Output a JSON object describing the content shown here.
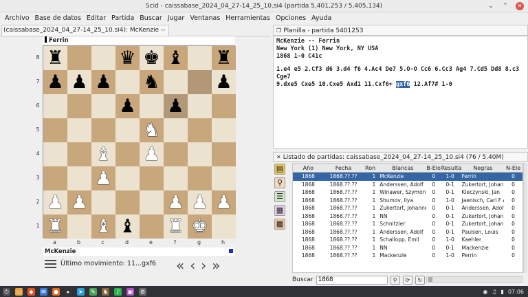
{
  "window": {
    "title": "Scid - caissabase_2024_04_27-14_25_10.si4 (partida 5,401,253 / 5,405,134)"
  },
  "menu": [
    "Archivo",
    "Base de datos",
    "Editar",
    "Partida",
    "Buscar",
    "Jugar",
    "Ventanas",
    "Herramientas",
    "Opciones",
    "Ayuda"
  ],
  "board_panel": {
    "tab_label": "(caissabase_2024_04_27-14_25_10.si4): McKenzie -- Ferrin",
    "top_player": "Ferrin",
    "bottom_player": "McKenzie",
    "last_move_label": "Último movimiento: 11...gxf6",
    "ranks": [
      "8",
      "7",
      "6",
      "5",
      "4",
      "3",
      "2",
      "1"
    ],
    "files": [
      "a",
      "b",
      "c",
      "d",
      "e",
      "f",
      "g",
      "h"
    ],
    "position": [
      [
        "bR",
        "",
        "",
        "bQ",
        "bK",
        "bB",
        "",
        "bR"
      ],
      [
        "bP",
        "bP",
        "bP",
        "",
        "bN",
        "",
        "",
        "bP"
      ],
      [
        "",
        "",
        "",
        "bP",
        "",
        "bP",
        "",
        ""
      ],
      [
        "",
        "",
        "",
        "",
        "wN",
        "",
        "",
        ""
      ],
      [
        "",
        "",
        "wB",
        "",
        "wP",
        "",
        "",
        ""
      ],
      [
        "",
        "",
        "wP",
        "",
        "",
        "",
        "",
        ""
      ],
      [
        "wP",
        "wP",
        "",
        "",
        "",
        "wP",
        "wP",
        "wP"
      ],
      [
        "wR",
        "",
        "wB",
        "bB",
        "",
        "wR",
        "wK",
        ""
      ]
    ],
    "nav": [
      "«",
      "‹",
      "›",
      "»"
    ]
  },
  "notation_panel": {
    "tab_label": "Planilla - partida 5401253",
    "players": "McKenzie  --  Ferrin",
    "event": "New York (1)  New York, NY USA",
    "info": "1868  1-0  C41c",
    "moves_line1": "1.e4 e5 2.Cf3 d6 3.d4 f6 4.Ac4 De7 5.O-O Cc6 6.Cc3 Ag4 7.Cd5 Dd8 8.c3 Cge7",
    "moves_line2_before": "9.dxe5 Cxe5 10.Cxe5 Axd1 11.Cxf6+ ",
    "moves_current": "gxf6",
    "moves_line2_after": " 12.Af7# 1-0"
  },
  "game_list": {
    "tab_label": "Listado de partidas: caissabase_2024_04_27-14_25_10.si4 (76 / 5.40M)",
    "columns": [
      "Año",
      "Fecha",
      "Ron",
      "Blancas",
      "B-Elo",
      "Resulta",
      "Negras",
      "N-Ele"
    ],
    "rows": [
      [
        "1868",
        "1868.??.??",
        "1",
        "McKenzie",
        "0",
        "1-0",
        "Ferrin",
        "0"
      ],
      [
        "1868",
        "1868.??.??",
        "1",
        "Anderssen, Adolf",
        "0",
        "0-1",
        "Zukertort, Johanne",
        "0"
      ],
      [
        "1868",
        "1868.??.??",
        "1",
        "Winawer, Szymon",
        "0",
        "0-1",
        "Kleczynski, Jan",
        "0"
      ],
      [
        "1868",
        "1868.??.??",
        "1",
        "Shumov, Ilya",
        "0",
        "1-0",
        "Jaenisch, Carl F A",
        "0"
      ],
      [
        "1868",
        "1868.??.??",
        "1",
        "Zukertort, Johanne",
        "0",
        "0-1",
        "Anderssen, Adolf",
        "0"
      ],
      [
        "1868",
        "1868.??.??",
        "1",
        "NN",
        "0",
        "0-1",
        "Zukertort, Johanne",
        "0"
      ],
      [
        "1868",
        "1868.??.??",
        "1",
        "Schnitzler",
        "0",
        "0-1",
        "Zukertort, Johanne",
        "0"
      ],
      [
        "1868",
        "1868.??.??",
        "1",
        "Anderssen, Adolf",
        "0",
        "0-1",
        "Paulsen, Louis",
        "0"
      ],
      [
        "1868",
        "1868.??.??",
        "1",
        "Schallopp, Emil",
        "0",
        "1-0",
        "Kaehler",
        "0"
      ],
      [
        "1868",
        "1868.??.??",
        "1",
        "NN",
        "0",
        "0-1",
        "Mackenzie",
        "0"
      ],
      [
        "1868",
        "1868.??.??",
        "1",
        "Mackenzie",
        "0",
        "1-0",
        "Perrin",
        "0"
      ]
    ],
    "search_label": "Buscar",
    "search_value": "1868"
  },
  "taskbar": {
    "clock": "07:06"
  }
}
